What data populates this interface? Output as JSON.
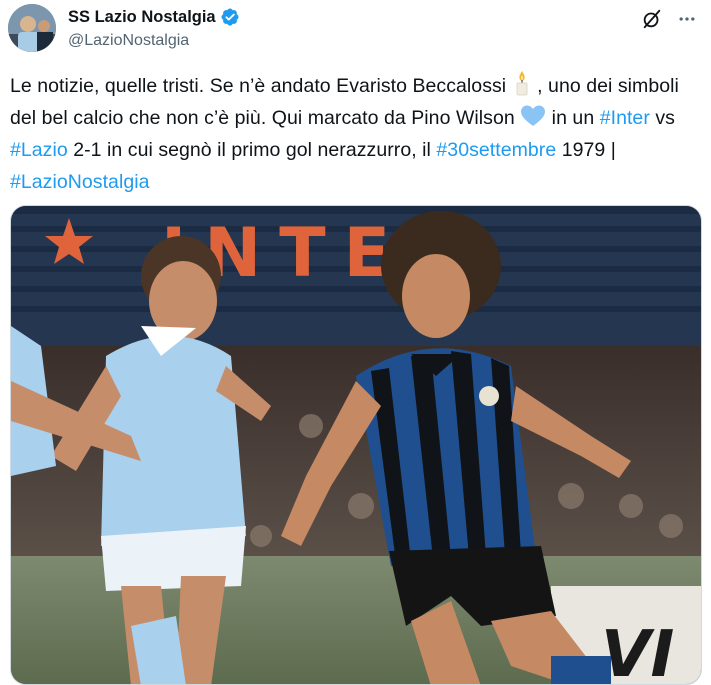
{
  "author": {
    "display_name": "SS Lazio Nostalgia",
    "handle": "@LazioNostalgia",
    "verified": true,
    "avatar_icon": "avatar-photo"
  },
  "actions": {
    "grok_icon": "grok-icon",
    "more_icon": "more-dots-icon"
  },
  "tweet": {
    "seg1": "Le notizie, quelle tristi. Se n’è andato Evaristo Beccalossi ",
    "emoji_candle": "candle",
    "seg2": " , uno dei simboli del bel calcio che non c’è più. Qui marcato da Pino Wilson ",
    "emoji_heart": "light-blue-heart",
    "seg3": "  in un ",
    "hashtag_inter": "#Inter",
    "seg4": " vs ",
    "hashtag_lazio": "#Lazio",
    "seg5": " 2-1 in cui segnò il primo gol nerazzurro, il ",
    "hashtag_date": "#30settembre",
    "seg6": " 1979 | ",
    "hashtag_nostalgia": "#LazioNostalgia"
  },
  "media": {
    "description_icon": "football-match-photo",
    "banner_text": "INTER",
    "ad_text": "VI"
  },
  "colors": {
    "link": "#1d9bf0",
    "text": "#0f1419",
    "secondary": "#536471",
    "verified": "#1d9bf0",
    "heart": "#89c4f4"
  }
}
